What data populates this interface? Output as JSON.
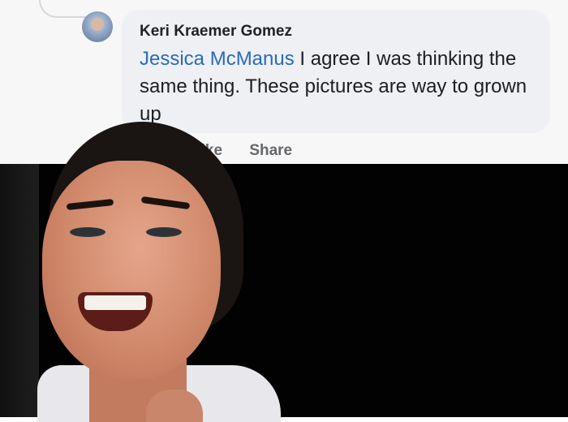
{
  "comment": {
    "author": "Keri Kraemer Gomez",
    "mention": "Jessica McManus",
    "text": " I agree I was thinking the same thing. These pictures are way to grown up"
  },
  "actions": {
    "like_label": "Like",
    "share_label": "Share"
  },
  "colors": {
    "mention": "#2a6ab8",
    "bubble": "#eef0f3",
    "action_text": "#65676b",
    "video_bg": "#020203"
  }
}
